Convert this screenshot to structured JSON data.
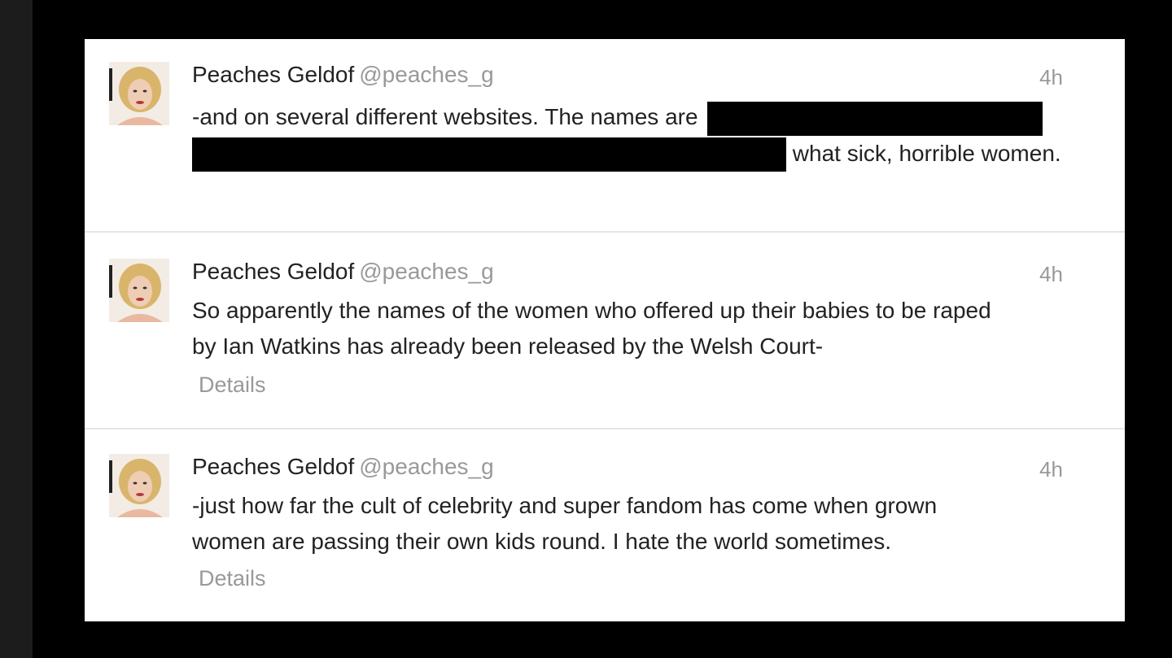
{
  "tweets": [
    {
      "name": "Peaches Geldof",
      "handle": "@peaches_g",
      "time": "4h",
      "text_before": "-and on several different websites. The names are",
      "text_after": "what sick, horrible women.",
      "details": ""
    },
    {
      "name": "Peaches Geldof",
      "handle": "@peaches_g",
      "time": "4h",
      "line1": "So apparently the names of the women who offered up their babies to be raped",
      "line2": "by Ian Watkins has already been released by the Welsh Court-",
      "details": "Details"
    },
    {
      "name": "Peaches Geldof",
      "handle": "@peaches_g",
      "time": "4h",
      "line1": "-just how far the cult of celebrity and super fandom has come when grown",
      "line2": "women are passing their own kids round. I hate the world sometimes.",
      "details": "Details"
    }
  ]
}
